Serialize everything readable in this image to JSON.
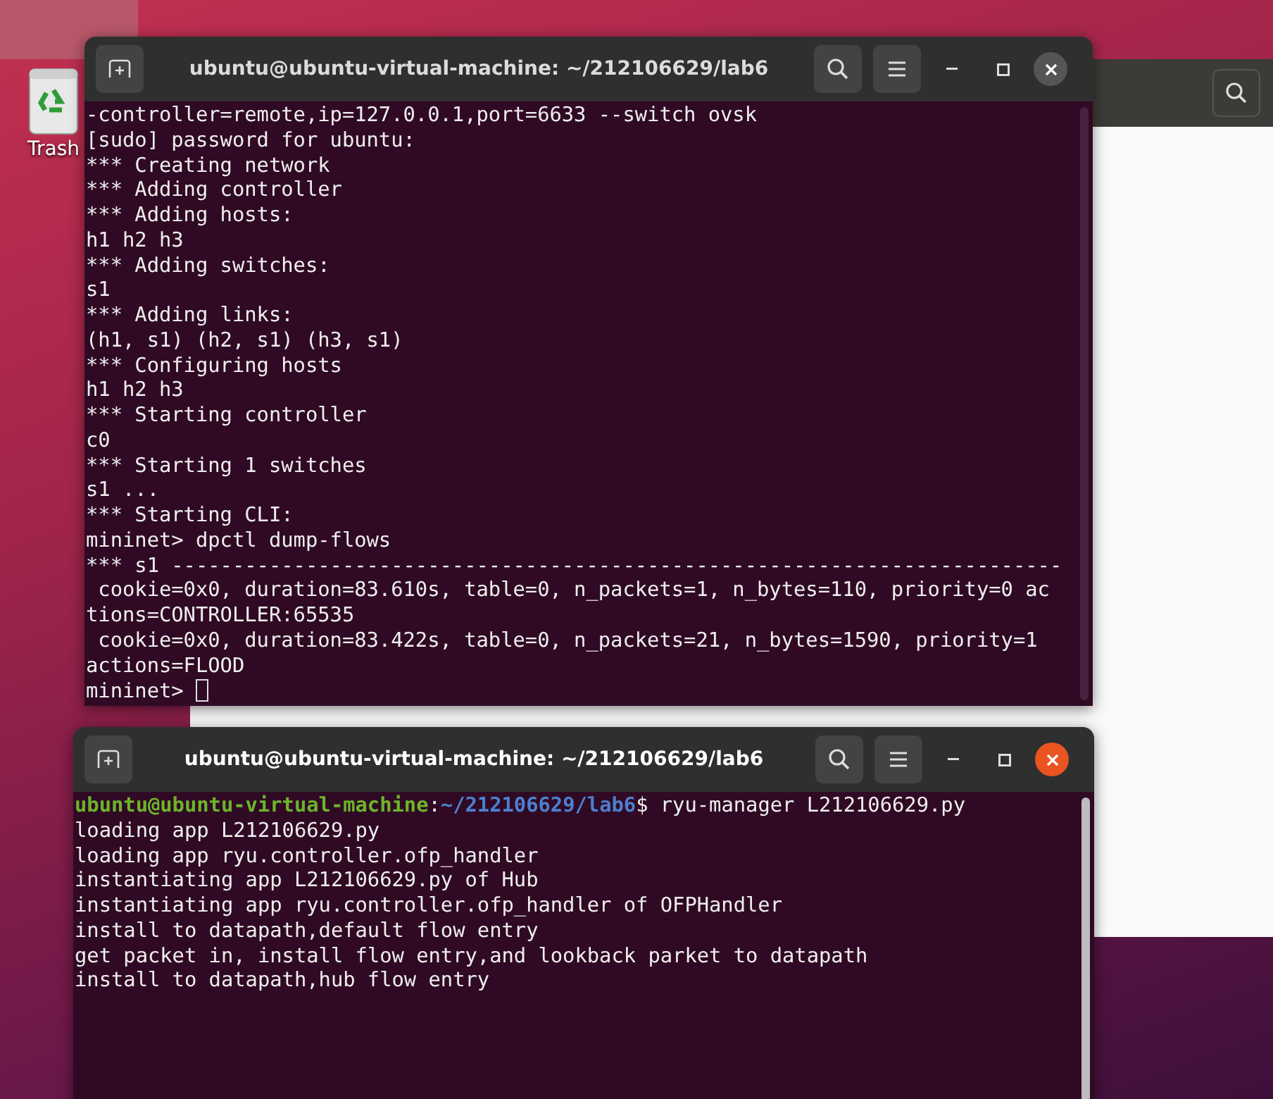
{
  "desktop": {
    "icons": [
      {
        "label": "Trash"
      }
    ]
  },
  "windows": [
    {
      "title": "ubuntu@ubuntu-virtual-machine: ~/212106629/lab6",
      "focused": false,
      "cursor": true,
      "lines": [
        "-controller=remote,ip=127.0.0.1,port=6633 --switch ovsk",
        "[sudo] password for ubuntu:",
        "*** Creating network",
        "*** Adding controller",
        "*** Adding hosts:",
        "h1 h2 h3",
        "*** Adding switches:",
        "s1",
        "*** Adding links:",
        "(h1, s1) (h2, s1) (h3, s1)",
        "*** Configuring hosts",
        "h1 h2 h3",
        "*** Starting controller",
        "c0",
        "*** Starting 1 switches",
        "s1 ...",
        "*** Starting CLI:",
        "mininet> dpctl dump-flows",
        "*** s1 -------------------------------------------------------------------------",
        " cookie=0x0, duration=83.610s, table=0, n_packets=1, n_bytes=110, priority=0 ac",
        "tions=CONTROLLER:65535",
        " cookie=0x0, duration=83.422s, table=0, n_packets=21, n_bytes=1590, priority=1",
        "actions=FLOOD",
        "mininet> "
      ]
    },
    {
      "title": "ubuntu@ubuntu-virtual-machine: ~/212106629/lab6",
      "focused": true,
      "prompt": {
        "user_host": "ubuntu@ubuntu-virtual-machine",
        "separator": ":",
        "path": "~/212106629/lab6",
        "command": "$ ryu-manager L212106629.py"
      },
      "lines": [
        "loading app L212106629.py",
        "loading app ryu.controller.ofp_handler",
        "instantiating app L212106629.py of Hub",
        "instantiating app ryu.controller.ofp_handler of OFPHandler",
        "install to datapath,default flow entry",
        "get packet in, install flow entry,and lookback parket to datapath",
        "install to datapath,hub flow entry"
      ]
    }
  ]
}
